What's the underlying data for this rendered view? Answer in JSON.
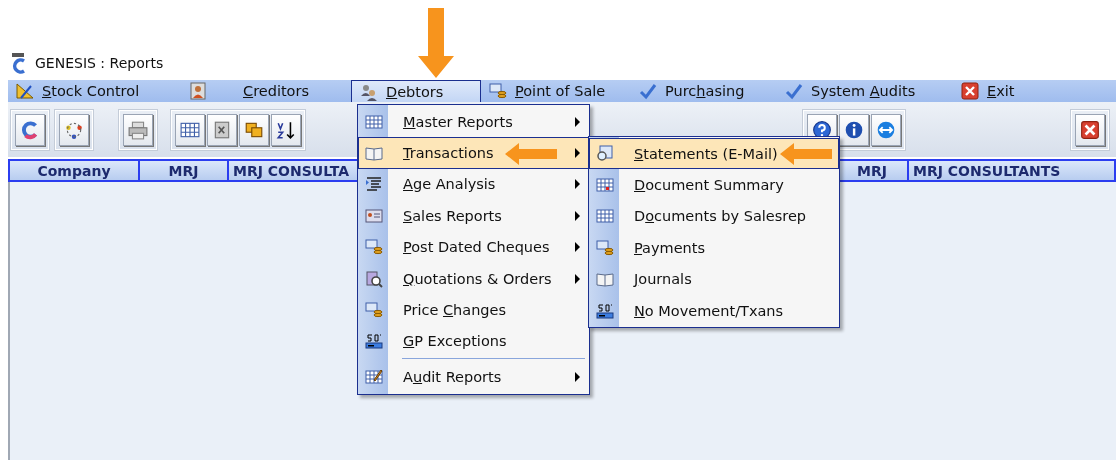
{
  "window": {
    "title": "GENESIS : Reports"
  },
  "menubar": [
    {
      "key": "S",
      "post": "tock Control",
      "selected": false
    },
    {
      "key": "C",
      "post": "reditors",
      "selected": false
    },
    {
      "key": "D",
      "post": "ebtors",
      "selected": true
    },
    {
      "key": "P",
      "post": "oint of Sale",
      "selected": false
    },
    {
      "pre": "Purc",
      "key": "h",
      "post": "asing",
      "selected": false
    },
    {
      "pre": "System ",
      "key": "A",
      "post": "udits",
      "selected": false
    },
    {
      "key": "E",
      "post": "xit",
      "selected": false
    }
  ],
  "header": [
    "Company",
    "MRJ",
    "MRJ CONSULTA",
    "MRJ",
    "MRJ CONSULTANTS"
  ],
  "debtors_menu": [
    {
      "key": "M",
      "post": "aster Reports",
      "submenu": true,
      "selected": false,
      "separator_before": false
    },
    {
      "key": "T",
      "post": "ransactions",
      "submenu": true,
      "selected": true,
      "separator_before": false
    },
    {
      "key": "A",
      "post": "ge Analysis",
      "submenu": true,
      "selected": false,
      "separator_before": false
    },
    {
      "key": "S",
      "post": "ales Reports",
      "submenu": true,
      "selected": false,
      "separator_before": false
    },
    {
      "key": "P",
      "post": "ost Dated Cheques",
      "submenu": true,
      "selected": false,
      "separator_before": false
    },
    {
      "key": "Q",
      "post": "uotations & Orders",
      "submenu": true,
      "selected": false,
      "separator_before": false
    },
    {
      "pre": "Price ",
      "key": "C",
      "post": "hanges",
      "submenu": false,
      "selected": false,
      "separator_before": false
    },
    {
      "key": "G",
      "post": "P Exceptions",
      "submenu": false,
      "selected": false,
      "separator_before": false
    },
    {
      "pre": "A",
      "key": "u",
      "post": "dit Reports",
      "submenu": true,
      "selected": false,
      "separator_before": true
    }
  ],
  "transactions_menu": [
    {
      "key": "S",
      "post": "tatements (E-Mail)",
      "selected": true
    },
    {
      "key": "D",
      "post": "ocument Summary",
      "selected": false
    },
    {
      "pre": "D",
      "key": "o",
      "post": "cuments by Salesrep",
      "selected": false
    },
    {
      "key": "P",
      "post": "ayments",
      "selected": false
    },
    {
      "key": "J",
      "post": "ournals",
      "selected": false
    },
    {
      "key": "N",
      "post": "o Movement/Txans",
      "selected": false
    }
  ]
}
